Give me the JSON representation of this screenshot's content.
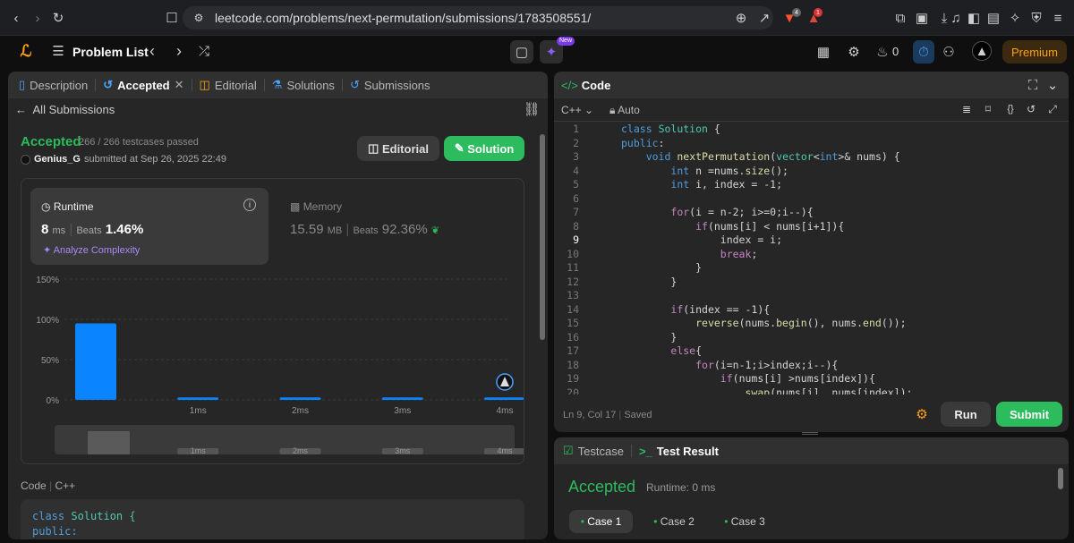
{
  "browser": {
    "url": "leetcode.com/problems/next-permutation/submissions/1783508551/",
    "badge_a": "4",
    "badge_b": "1"
  },
  "header": {
    "problem_list": "Problem List",
    "new_badge": "New",
    "streak": "0",
    "premium": "Premium"
  },
  "left_tabs": [
    "Description",
    "Accepted",
    "Editorial",
    "Solutions",
    "Submissions"
  ],
  "all_submissions": "All Submissions",
  "result": {
    "status": "Accepted",
    "tests": "266 / 266 testcases passed",
    "user": "Genius_G",
    "submitted": "submitted at Sep 26, 2025 22:49",
    "editorial_btn": "Editorial",
    "solution_btn": "Solution"
  },
  "runtime": {
    "label": "Runtime",
    "value": "8",
    "unit": "ms",
    "beats_label": "Beats",
    "beats": "1.46%",
    "analyze": "Analyze Complexity"
  },
  "memory": {
    "label": "Memory",
    "value": "15.59",
    "unit": "MB",
    "beats_label": "Beats",
    "beats": "92.36%"
  },
  "chart_data": {
    "type": "bar",
    "categories": [
      "",
      "1ms",
      "2ms",
      "3ms",
      "4ms"
    ],
    "values": [
      95,
      3,
      3,
      3,
      3
    ],
    "ylim": [
      0,
      150
    ],
    "yticks": [
      "150%",
      "100%",
      "50%",
      "0%"
    ],
    "mini_labels": [
      "1ms",
      "2ms",
      "3ms",
      "4ms"
    ]
  },
  "code_section": {
    "label": "Code",
    "lang": "C++",
    "lines": [
      "class Solution {",
      "public:"
    ]
  },
  "editor": {
    "title": "Code",
    "lang": "C++",
    "mode": "Auto",
    "status_pos": "Ln 9, Col 17",
    "status_saved": "Saved",
    "run": "Run",
    "submit": "Submit"
  },
  "code_lines": [
    "class Solution {",
    "public:",
    "    void nextPermutation(vector<int>& nums) {",
    "        int n =nums.size();",
    "        int i, index = -1;",
    "",
    "        for(i = n-2; i>=0;i--){",
    "            if(nums[i] < nums[i+1]){",
    "                index = i;",
    "                break;",
    "            }",
    "        }",
    "",
    "        if(index == -1){",
    "            reverse(nums.begin(), nums.end());",
    "        }",
    "        else{",
    "            for(i=n-1;i>index;i--){",
    "                if(nums[i] >nums[index]){",
    "                    swap(nums[i], nums[index]);"
  ],
  "bottom": {
    "testcase": "Testcase",
    "test_result": "Test Result",
    "status": "Accepted",
    "runtime": "Runtime: 0 ms",
    "cases": [
      "Case 1",
      "Case 2",
      "Case 3"
    ]
  }
}
